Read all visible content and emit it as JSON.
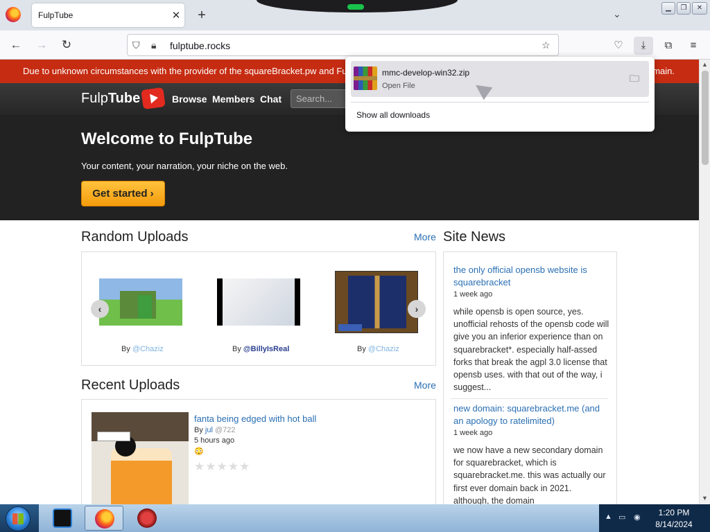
{
  "browser": {
    "tab_title": "FulpTube",
    "url": "fulptube.rocks",
    "new_tab": "+",
    "tab_close": "✕"
  },
  "page": {
    "banner_text": "Due to unknown circumstances with the provider of the squareBracket.pw and Fu",
    "banner_tail": "main.",
    "logo_part1": "Fulp",
    "logo_part2": "Tube",
    "nav": {
      "browse": "Browse",
      "members": "Members",
      "chat": "Chat"
    },
    "search_placeholder": "Search...",
    "hero_title": "Welcome to FulpTube",
    "hero_tagline": "Your content, your narration, your niche on the web.",
    "cta_label": "Get started ›",
    "random_uploads": {
      "title": "Random Uploads",
      "more": "More",
      "items": [
        {
          "by": "By",
          "user": "@Chaziz"
        },
        {
          "by": "By",
          "user": "@BillyIsReal"
        },
        {
          "by": "By",
          "user": "@Chaziz"
        }
      ]
    },
    "recent_uploads": {
      "title": "Recent Uploads",
      "more": "More",
      "item": {
        "title": "fanta being edged with hot ball",
        "by": "By",
        "author": "jul",
        "handle": "@722",
        "time": "5 hours ago",
        "emoji": "😳",
        "stars": "★★★★★",
        "rating": 0
      }
    },
    "site_news": {
      "title": "Site News",
      "items": [
        {
          "title": "the only official opensb website is squarebracket",
          "date": "1 week ago",
          "body": "while opensb is open source, yes. unofficial rehosts of the opensb code will give you an inferior experience than on squarebracket*. especially half-assed forks that break the agpl 3.0 license that opensb uses. with that out of the way, i suggest..."
        },
        {
          "title": "new domain: squarebracket.me (and an apology to ratelimited)",
          "date": "1 week ago",
          "body": "we now have a new secondary domain for squarebracket, which is squarebracket.me. this was actually our first ever domain back in 2021. although, the domain"
        }
      ]
    }
  },
  "downloads": {
    "file_name": "mmc-develop-win32.zip",
    "status": "Open File",
    "show_all": "Show all downloads"
  },
  "taskbar": {
    "time": "1:20 PM",
    "date": "8/14/2024"
  },
  "colors": {
    "banner": "#c62c12",
    "link": "#2a6fb3",
    "cta": "#f7a823"
  }
}
